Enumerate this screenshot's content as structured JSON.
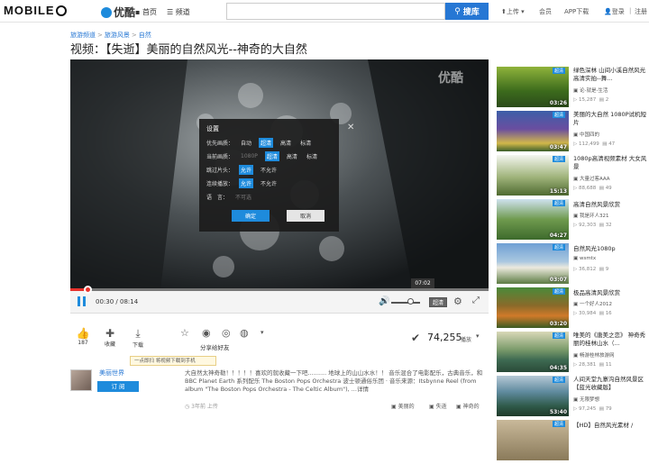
{
  "header": {
    "site_logo": "MOBILE",
    "brand": "优酷",
    "nav": [
      "首页",
      "频道"
    ],
    "search_placeholder": "",
    "search_button": "搜库",
    "upload": "上传",
    "links": [
      "会员",
      "APP下载",
      "登录",
      "注册"
    ]
  },
  "breadcrumb": [
    "旅游频道",
    "旅游风景",
    "自然"
  ],
  "video": {
    "title": "视频：【失逝】美丽的自然风光--神奇的大自然",
    "watermark": "优酷",
    "progress": 0.04,
    "time_current": "00:30",
    "time_total": "08:14",
    "time_tooltip": "07:02",
    "quality_label": "超清"
  },
  "settings_dialog": {
    "title": "设置",
    "rows": [
      {
        "label": "优先画质：",
        "options": [
          "自动",
          "超清",
          "高清",
          "标清"
        ],
        "selected": 1
      },
      {
        "label": "当前画质：",
        "options": [
          "1080P",
          "超清",
          "高清",
          "标清"
        ],
        "selected": 1
      },
      {
        "label": "跳过片头：",
        "options": [
          "允许",
          "不允许"
        ],
        "selected": 0
      },
      {
        "label": "连续播放：",
        "options": [
          "允许",
          "不允许"
        ],
        "selected": 0
      },
      {
        "label": "语　言：",
        "options": [
          "不可选"
        ],
        "selected": -1
      }
    ],
    "ok": "确定",
    "cancel": "取消"
  },
  "actions": {
    "like_count": "187",
    "favorite": "收藏",
    "download": "下载",
    "share": "分享给好友",
    "download_tip": "一点即扫 将视频下载到手机",
    "plays": "74,255",
    "plays_label": "播放"
  },
  "channel": {
    "name": "美丽世界",
    "subscribe": "订 阅",
    "time": "3年前 上传",
    "description": "大自然太神奇勒！！！！！喜欢的就收藏一下吧.......... 地球上的山山水水！！ 音乐混合了电影配乐，古典音乐，和 BBC Planet Earth 系列配乐 The Boston Pops Orchestra 波士顿通俗乐团 · 音乐来源：Itsbynne Reel (from album \"The Boston Pops Orchestra - The Celtic Album\"), ...详情",
    "tags": [
      "美丽的",
      "失逝",
      "神奇的"
    ]
  },
  "related": [
    {
      "title": "绿色深林 山间小溪自然风光高清实拍--舞...",
      "user": "论-就是-生活",
      "plays": "15,287",
      "comments": "2",
      "duration": "03:26",
      "badge": "超清"
    },
    {
      "title": "美丽的大自然 1080P试机短片",
      "user": "中国四的",
      "plays": "112,499",
      "comments": "47",
      "duration": "03:47",
      "badge": "超清"
    },
    {
      "title": "1080p高清视频素材 大女风景",
      "user": "大量过客AAA",
      "plays": "88,688",
      "comments": "49",
      "duration": "15:13",
      "badge": "超清"
    },
    {
      "title": "高清自然风景欣赏",
      "user": "我是环人321",
      "plays": "92,303",
      "comments": "32",
      "duration": "04:27",
      "badge": "超清"
    },
    {
      "title": "自然风光1080p",
      "user": "wsmtx",
      "plays": "36,812",
      "comments": "9",
      "duration": "03:07",
      "badge": "超清"
    },
    {
      "title": "极品高清风景欣赏",
      "user": "一个好人2012",
      "plays": "30,984",
      "comments": "16",
      "duration": "03:20",
      "badge": "超清"
    },
    {
      "title": "唯美的《唐美之恋》 神奇秀丽的桂林山水（...",
      "user": "畅游桂林旅游网",
      "plays": "28,381",
      "comments": "11",
      "duration": "04:35",
      "badge": "超清"
    },
    {
      "title": "人间天堂九寨沟自然风景区【蓝光收藏版】",
      "user": "无限梦想",
      "plays": "97,245",
      "comments": "79",
      "duration": "53:40",
      "badge": "超清"
    },
    {
      "title": "【HD】自然风光素材 /",
      "user": "",
      "plays": "",
      "comments": "",
      "duration": "",
      "badge": "超清"
    }
  ]
}
